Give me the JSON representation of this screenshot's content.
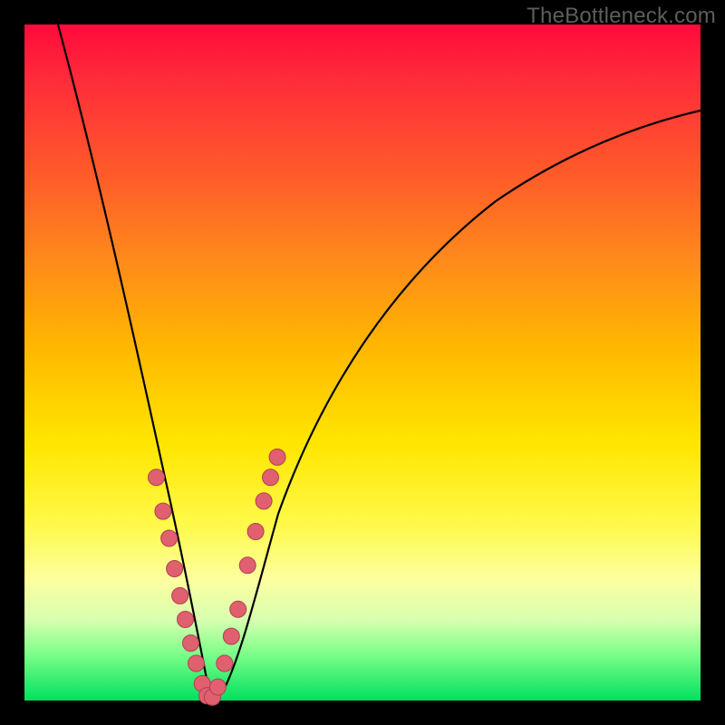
{
  "watermark": "TheBottleneck.com",
  "chart_data": {
    "type": "line",
    "title": "",
    "xlabel": "",
    "ylabel": "",
    "xlim": [
      0,
      100
    ],
    "ylim": [
      0,
      100
    ],
    "grid": false,
    "legend": false,
    "series": [
      {
        "name": "bottleneck-curve",
        "shape": "V",
        "minimum_x": 27,
        "minimum_y": 0,
        "x": [
          5,
          10,
          15,
          20,
          23,
          25,
          27,
          29,
          31,
          35,
          40,
          50,
          60,
          70,
          80,
          90,
          100
        ],
        "y": [
          100,
          78,
          55,
          30,
          14,
          5,
          0,
          3,
          10,
          25,
          40,
          58,
          68,
          75,
          80,
          83,
          85
        ]
      }
    ],
    "markers": {
      "name": "highlighted-points",
      "color": "#e06070",
      "x": [
        19.5,
        20.5,
        21.4,
        22.2,
        23.0,
        23.8,
        24.6,
        25.4,
        26.3,
        27.0,
        27.8,
        28.6,
        29.6,
        30.6,
        31.6,
        33.0,
        34.2,
        35.4,
        36.4,
        37.4
      ],
      "y": [
        33,
        28,
        24,
        19.5,
        15.5,
        12,
        8.5,
        5.5,
        2.5,
        0.7,
        0.5,
        2,
        5.5,
        9.5,
        13.5,
        20,
        25,
        29.5,
        33,
        36
      ]
    }
  },
  "colors": {
    "gradient_top": "#ff0a3a",
    "gradient_bottom": "#00e05e",
    "frame": "#000000",
    "marker": "#e06070"
  }
}
